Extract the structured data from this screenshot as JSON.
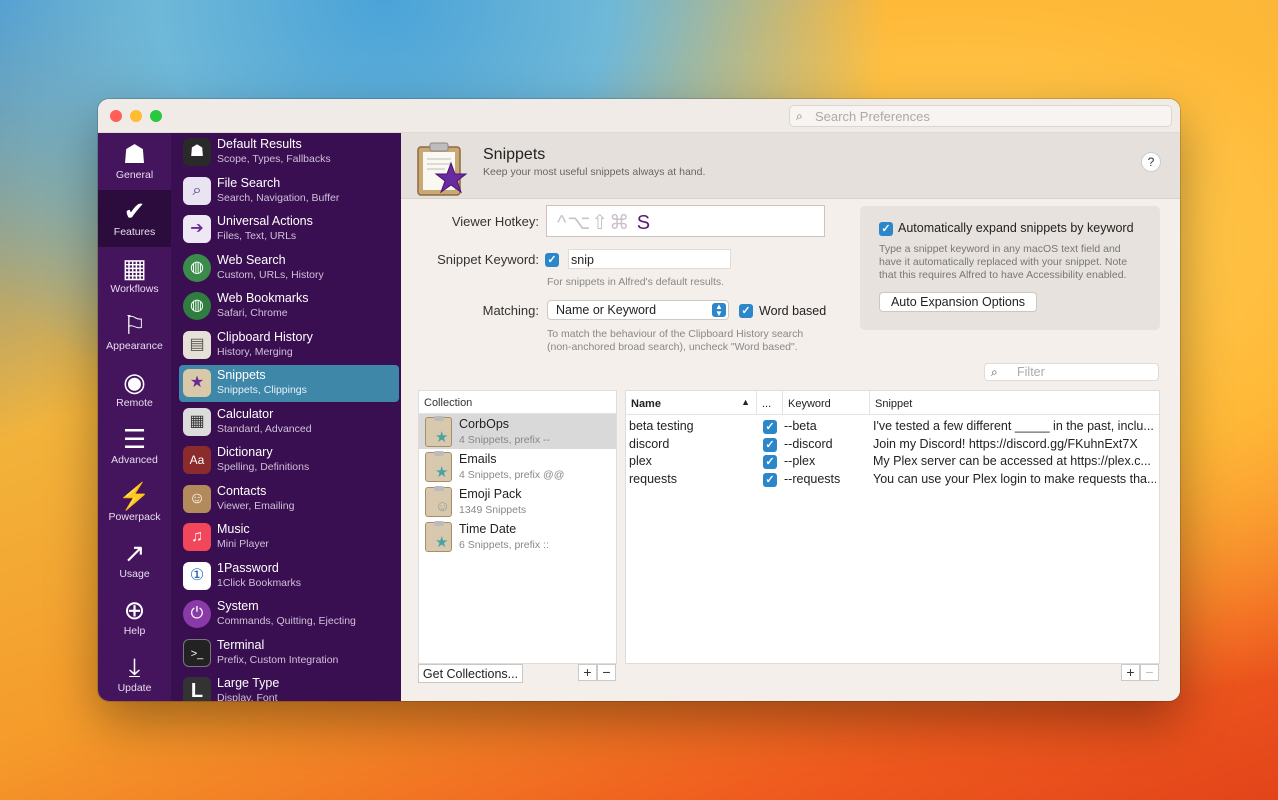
{
  "search": {
    "placeholder": "Search Preferences"
  },
  "iconbar": [
    {
      "label": "General",
      "icon": "hat-icon",
      "glyph": "☗"
    },
    {
      "label": "Features",
      "icon": "check-icon",
      "glyph": "✔"
    },
    {
      "label": "Workflows",
      "icon": "grid-icon",
      "glyph": "▦"
    },
    {
      "label": "Appearance",
      "icon": "paint-roller-icon",
      "glyph": "⚐"
    },
    {
      "label": "Remote",
      "icon": "remote-icon",
      "glyph": "◉"
    },
    {
      "label": "Advanced",
      "icon": "sliders-icon",
      "glyph": "☰"
    },
    {
      "label": "Powerpack",
      "icon": "battery-icon",
      "glyph": "⚡"
    },
    {
      "label": "Usage",
      "icon": "chart-icon",
      "glyph": "↗"
    },
    {
      "label": "Help",
      "icon": "lifebuoy-icon",
      "glyph": "⊕"
    },
    {
      "label": "Update",
      "icon": "download-icon",
      "glyph": "⤓"
    }
  ],
  "sidebar": [
    {
      "title": "Default Results",
      "sub": "Scope, Types, Fallbacks",
      "icon": "hat-icon",
      "glyph": "☗",
      "color": "#2a2a2a"
    },
    {
      "title": "File Search",
      "sub": "Search, Navigation, Buffer",
      "icon": "file-search-icon",
      "glyph": "🔍",
      "color": "#e9e4f2"
    },
    {
      "title": "Universal Actions",
      "sub": "Files, Text, URLs",
      "icon": "actions-icon",
      "glyph": "➔",
      "color": "#ede8f3"
    },
    {
      "title": "Web Search",
      "sub": "Custom, URLs, History",
      "icon": "globe-search-icon",
      "glyph": "◍",
      "color": "#3b8c4b"
    },
    {
      "title": "Web Bookmarks",
      "sub": "Safari, Chrome",
      "icon": "globe-icon",
      "glyph": "◍",
      "color": "#2f7d3f"
    },
    {
      "title": "Clipboard History",
      "sub": "History, Merging",
      "icon": "clipboard-icon",
      "glyph": "▤",
      "color": "#e6e0d6"
    },
    {
      "title": "Snippets",
      "sub": "Snippets, Clippings",
      "icon": "snippets-icon",
      "glyph": "★",
      "color": "#d9c9a8"
    },
    {
      "title": "Calculator",
      "sub": "Standard, Advanced",
      "icon": "calculator-icon",
      "glyph": "▦",
      "color": "#dcdcdc"
    },
    {
      "title": "Dictionary",
      "sub": "Spelling, Definitions",
      "icon": "dictionary-icon",
      "glyph": "Aa",
      "color": "#8b2b2b"
    },
    {
      "title": "Contacts",
      "sub": "Viewer, Emailing",
      "icon": "contacts-icon",
      "glyph": "☺",
      "color": "#b38a5c"
    },
    {
      "title": "Music",
      "sub": "Mini Player",
      "icon": "music-icon",
      "glyph": "♫",
      "color": "#f2465a"
    },
    {
      "title": "1Password",
      "sub": "1Click Bookmarks",
      "icon": "onepassword-icon",
      "glyph": "①",
      "color": "#ffffff"
    },
    {
      "title": "System",
      "sub": "Commands, Quitting, Ejecting",
      "icon": "power-icon",
      "glyph": "⏻",
      "color": "#8a3aa8"
    },
    {
      "title": "Terminal",
      "sub": "Prefix, Custom Integration",
      "icon": "terminal-icon",
      "glyph": ">_",
      "color": "#222222"
    },
    {
      "title": "Large Type",
      "sub": "Display, Font",
      "icon": "large-type-icon",
      "glyph": "L",
      "color": "#333333"
    }
  ],
  "header": {
    "title": "Snippets",
    "subtitle": "Keep your most useful snippets always at hand.",
    "help": "?"
  },
  "form": {
    "hotkey_label": "Viewer Hotkey:",
    "hotkey_dim": "^⌥⇧⌘",
    "hotkey_key": "S",
    "keyword_label": "Snippet Keyword:",
    "keyword_value": "snip",
    "keyword_note": "For snippets in Alfred's default results.",
    "matching_label": "Matching:",
    "matching_value": "Name or Keyword",
    "word_based": "Word based",
    "matching_note_1": "To match the behaviour of the Clipboard History search",
    "matching_note_2": "(non-anchored broad search), uncheck \"Word based\"."
  },
  "auto": {
    "label": "Automatically expand snippets by keyword",
    "desc_1": "Type a snippet keyword in any macOS text field and",
    "desc_2": "have it automatically replaced with your snippet. Note",
    "desc_3": "that this requires Alfred to have Accessibility enabled.",
    "button": "Auto Expansion Options"
  },
  "filter": {
    "placeholder": "Filter"
  },
  "collections": {
    "header": "Collection",
    "items": [
      {
        "name": "CorbOps",
        "sub": "4 Snippets, prefix --"
      },
      {
        "name": "Emails",
        "sub": "4 Snippets, prefix @@"
      },
      {
        "name": "Emoji Pack",
        "sub": "1349 Snippets"
      },
      {
        "name": "Time Date",
        "sub": "6 Snippets, prefix ::"
      }
    ],
    "get_button": "Get Collections...",
    "plus": "+",
    "minus": "−"
  },
  "snippets": {
    "columns": [
      "Name",
      "...",
      "Keyword",
      "Snippet"
    ],
    "rows": [
      {
        "name": "beta testing",
        "keyword": "--beta",
        "snippet": "I've tested a few different _____ in the past, inclu..."
      },
      {
        "name": "discord",
        "keyword": "--discord",
        "snippet": "Join my Discord! https://discord.gg/FKuhnExt7X"
      },
      {
        "name": "plex",
        "keyword": "--plex",
        "snippet": "My Plex server can be accessed at https://plex.c..."
      },
      {
        "name": "requests",
        "keyword": "--requests",
        "snippet": "You can use your Plex login to make requests tha..."
      }
    ],
    "plus": "+",
    "minus": "−"
  }
}
